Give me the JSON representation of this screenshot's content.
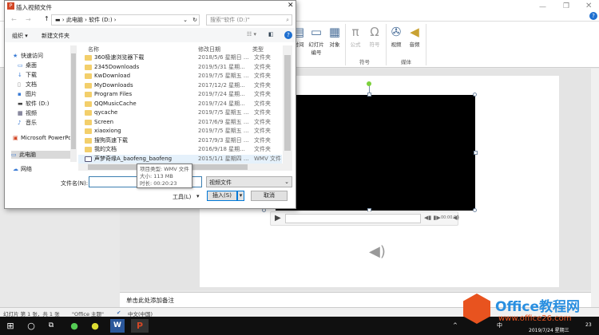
{
  "ribbon": {
    "buttons": [
      {
        "label": "时间",
        "icon": "datetime-icon"
      },
      {
        "label": "幻灯片编号",
        "icon": "slide-number-icon"
      },
      {
        "label": "对象",
        "icon": "object-icon"
      },
      {
        "label": "公式",
        "icon": "pi-icon",
        "glyph": "π"
      },
      {
        "label": "符号",
        "icon": "omega-icon",
        "glyph": "Ω"
      },
      {
        "label": "视频",
        "icon": "video-reel-icon"
      },
      {
        "label": "音频",
        "icon": "speaker-icon"
      }
    ],
    "groups": [
      "符号",
      "媒体"
    ]
  },
  "dialog": {
    "title": "插入视频文件",
    "breadcrumb": [
      "此电脑",
      "软件 (D:)"
    ],
    "search_placeholder": "搜索\"软件 (D:)\"",
    "organize": "组织 ▾",
    "new_folder": "新建文件夹",
    "nav": [
      "快速访问",
      "桌面",
      "下载",
      "文档",
      "图片",
      "软件 (D:)",
      "视频",
      "音乐",
      "Microsoft PowerPoint",
      "此电脑",
      "网络"
    ],
    "columns": [
      "名称",
      "修改日期",
      "类型"
    ],
    "files": [
      [
        "360极速浏览器下载",
        "2018/5/6 星期日 ...",
        "文件夹"
      ],
      [
        "2345Downloads",
        "2019/5/31 星期...",
        "文件夹"
      ],
      [
        "KwDownload",
        "2019/7/5 星期五 ...",
        "文件夹"
      ],
      [
        "MyDownloads",
        "2017/12/2 星期...",
        "文件夹"
      ],
      [
        "Program Files",
        "2019/7/24 星期...",
        "文件夹"
      ],
      [
        "QQMusicCache",
        "2019/7/24 星期...",
        "文件夹"
      ],
      [
        "qycache",
        "2019/7/5 星期五 ...",
        "文件夹"
      ],
      [
        "Screen",
        "2017/6/9 星期五 ...",
        "文件夹"
      ],
      [
        "xiaoxiong",
        "2019/7/5 星期五 ...",
        "文件夹"
      ],
      [
        "搜狗高速下载",
        "2017/9/3 星期日 ...",
        "文件夹"
      ],
      [
        "我的文档",
        "2016/9/18 星期...",
        "文件夹"
      ],
      [
        "声梦奇缘A_baofeng_baofeng",
        "2015/1/1 星期四 ...",
        "WMV 文件"
      ]
    ],
    "tooltip": [
      "项目类型: WMV 文件",
      "大小: 113 MB",
      "时长: 00:20:23"
    ],
    "filename_label": "文件名(N):",
    "filename_value": "",
    "filetype": "视频文件",
    "tools": "工具(L)",
    "insert": "插入(S)",
    "cancel": "取消"
  },
  "player": {
    "time": "00:00.00"
  },
  "notes_placeholder": "单击此处添加备注",
  "status": {
    "slide": "幻灯片 第 1 张，共 1 张",
    "theme": "\"Office 主题\"",
    "lang": "中文(中国)"
  },
  "taskbar": {
    "ime": "中",
    "date": "2019/7/24 星期三",
    "notif": "23"
  },
  "watermark": {
    "brand": "Office教程网",
    "url": "www.office26.com"
  }
}
